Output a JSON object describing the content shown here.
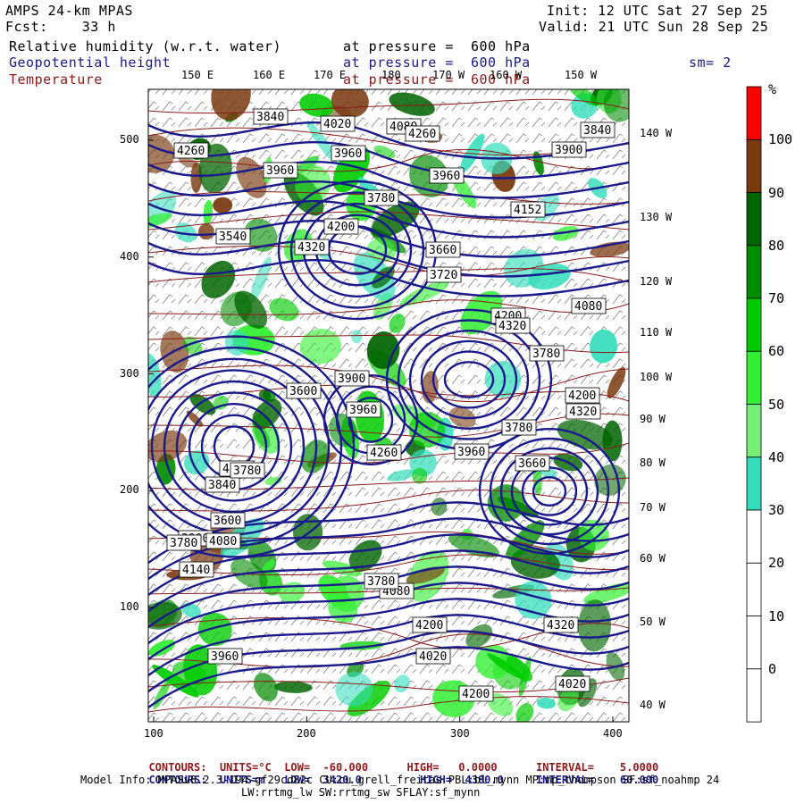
{
  "header": {
    "model": "AMPS 24-km MPAS",
    "forecast": "Fcst:    33 h",
    "init": "Init: 12 UTC Sat 27 Sep 25",
    "valid": "Valid: 21 UTC Sun 28 Sep 25",
    "fields": [
      {
        "name": "Relative humidity (w.r.t. water)",
        "level": "at pressure =  600 hPa",
        "color": "#000000"
      },
      {
        "name": "Geopotential height",
        "level": "at pressure =  600 hPa",
        "color": "#1a1a8c"
      },
      {
        "name": "Temperature",
        "level": "at pressure =  600 hPa",
        "color": "#8b1a1a"
      }
    ],
    "smoothing": "sm= 2"
  },
  "axes": {
    "y_ticks": [
      "500",
      "400",
      "300",
      "200",
      "100"
    ],
    "x_ticks": [
      "100",
      "200",
      "300",
      "400"
    ],
    "top_longitudes": [
      "150 E",
      "160 E",
      "170 E",
      "180",
      "170 W",
      "160 W",
      "150 W"
    ],
    "right_longitudes": [
      "140 W",
      "130 W",
      "120 W",
      "110 W",
      "100 W",
      "90 W",
      "80 W",
      "70 W",
      "60 W",
      "50 W",
      "40 W"
    ]
  },
  "colorbar": {
    "unit": "%",
    "labels": [
      "100",
      "90",
      "80",
      "70",
      "60",
      "50",
      "40",
      "30",
      "20",
      "10",
      "0"
    ],
    "colors": [
      "#ff0000",
      "#7a3a10",
      "#006400",
      "#008c00",
      "#00cc00",
      "#33ee33",
      "#77ee77",
      "#33ddbb",
      "#ffffff",
      "#ffffff",
      "#ffffff",
      "#ffffff"
    ]
  },
  "height_labels": [
    "4320",
    "3960",
    "4200",
    "4080",
    "4200",
    "4260",
    "4080",
    "3900",
    "3840",
    "4020",
    "3780",
    "3960",
    "3600",
    "3660",
    "3780",
    "3900",
    "4020",
    "3840",
    "3780",
    "3540",
    "3780",
    "3720",
    "3960",
    "3600",
    "3840",
    "3660",
    "4200",
    "3900",
    "3780",
    "3960",
    "4140",
    "4080",
    "4260",
    "4200",
    "4320",
    "4260",
    "4320",
    "4152",
    "4020",
    "4200",
    "3960",
    "3960",
    "4200",
    "3780",
    "4080",
    "4320"
  ],
  "footer": {
    "line1": {
      "label": "CONTOURS:",
      "units": "UNITS=°C",
      "low": "LOW=  -60.000",
      "high": "HIGH=   0.0000",
      "interval": "INTERVAL=    5.0000",
      "color": "#8b1a1a"
    },
    "line2": {
      "label": "CONTOURS:",
      "units": "UNITS=m",
      "low": "LOW=  3420.0",
      "high": "HIGH=  4380.0",
      "interval": "INTERVAL=    60.000",
      "color": "#1a1a8c"
    },
    "model_info": "Model Info: MPASv8.2.3-194-gf29cd82c CU:cu_grell_freitas PBL:bl_mynn MP:mp_thompson SF:sf_noahmp 24",
    "model_info2": "LW:rrtmg_lw SW:rrtmg_sw SFLAY:sf_mynn"
  }
}
